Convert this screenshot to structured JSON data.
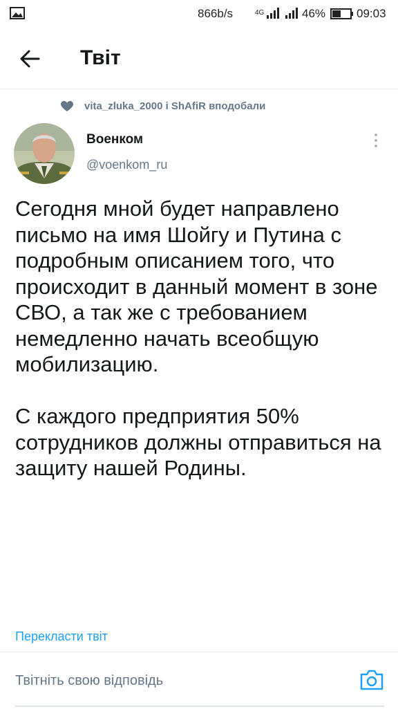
{
  "status_bar": {
    "net_speed": "866b/s",
    "net_type": "4G",
    "battery": "46%",
    "time": "09:03"
  },
  "header": {
    "title": "Твіт"
  },
  "social_context": {
    "text": "vita_zluka_2000 і ShAfiR вподобали"
  },
  "tweet": {
    "author_name": "Военком",
    "author_handle": "@voenkom_ru",
    "paragraph1": "Сегодня мной будет направлено письмо на имя Шойгу и Путина с подробным описанием того, что происходит в данный момент в зоне СВО, а так же с требованием немедленно начать всеобщую мобилизацию.",
    "paragraph2": "С каждого предприятия 50% сотрудников должны отправиться на защиту нашей Родины.",
    "translate_label": "Перекласти твіт"
  },
  "reply": {
    "placeholder": "Твітніть свою відповідь"
  },
  "colors": {
    "accent": "#1da1f2",
    "secondary_text": "#657786",
    "primary_text": "#14171a"
  }
}
